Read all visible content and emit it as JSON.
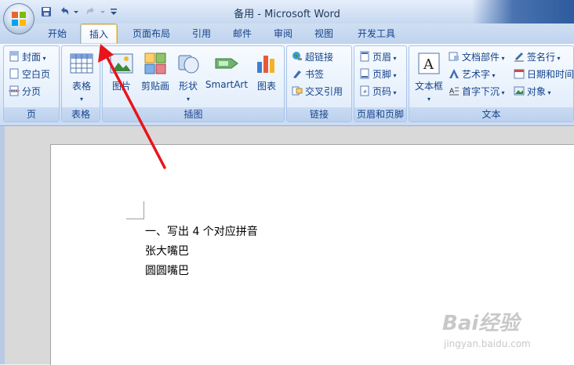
{
  "window": {
    "title": "备用 - Microsoft Word"
  },
  "colors": {
    "ribbon_text": "#15428b",
    "annotation_arrow": "#e8141a"
  },
  "tabs": [
    {
      "label": "开始",
      "active": false
    },
    {
      "label": "插入",
      "active": true
    },
    {
      "label": "页面布局",
      "active": false
    },
    {
      "label": "引用",
      "active": false
    },
    {
      "label": "邮件",
      "active": false
    },
    {
      "label": "审阅",
      "active": false
    },
    {
      "label": "视图",
      "active": false
    },
    {
      "label": "开发工具",
      "active": false
    }
  ],
  "ribbon": {
    "pages_group": {
      "label": "页",
      "cover": "封面",
      "blank": "空白页",
      "break": "分页"
    },
    "table_group": {
      "label": "表格",
      "table": "表格"
    },
    "illustrations_group": {
      "label": "插图",
      "picture": "图片",
      "clipart": "剪贴画",
      "shapes": "形状",
      "smartart": "SmartArt",
      "chart": "图表"
    },
    "links_group": {
      "label": "链接",
      "hyperlink": "超链接",
      "bookmark": "书签",
      "crossref": "交叉引用"
    },
    "header_group": {
      "label": "页眉和页脚",
      "header": "页眉",
      "footer": "页脚",
      "page_number": "页码"
    },
    "text_group": {
      "label": "文本",
      "textbox": "文本框",
      "quickparts": "文档部件",
      "wordart": "艺术字",
      "dropcap": "首字下沉",
      "signature": "签名行",
      "datetime": "日期和时间",
      "object": "对象"
    }
  },
  "document": {
    "lines": [
      "一、写出 4 个对应拼音",
      "张大嘴巴",
      "圆圆嘴巴"
    ]
  },
  "watermark": {
    "main": "Bai经验",
    "sub": "jingyan.baidu.com"
  }
}
